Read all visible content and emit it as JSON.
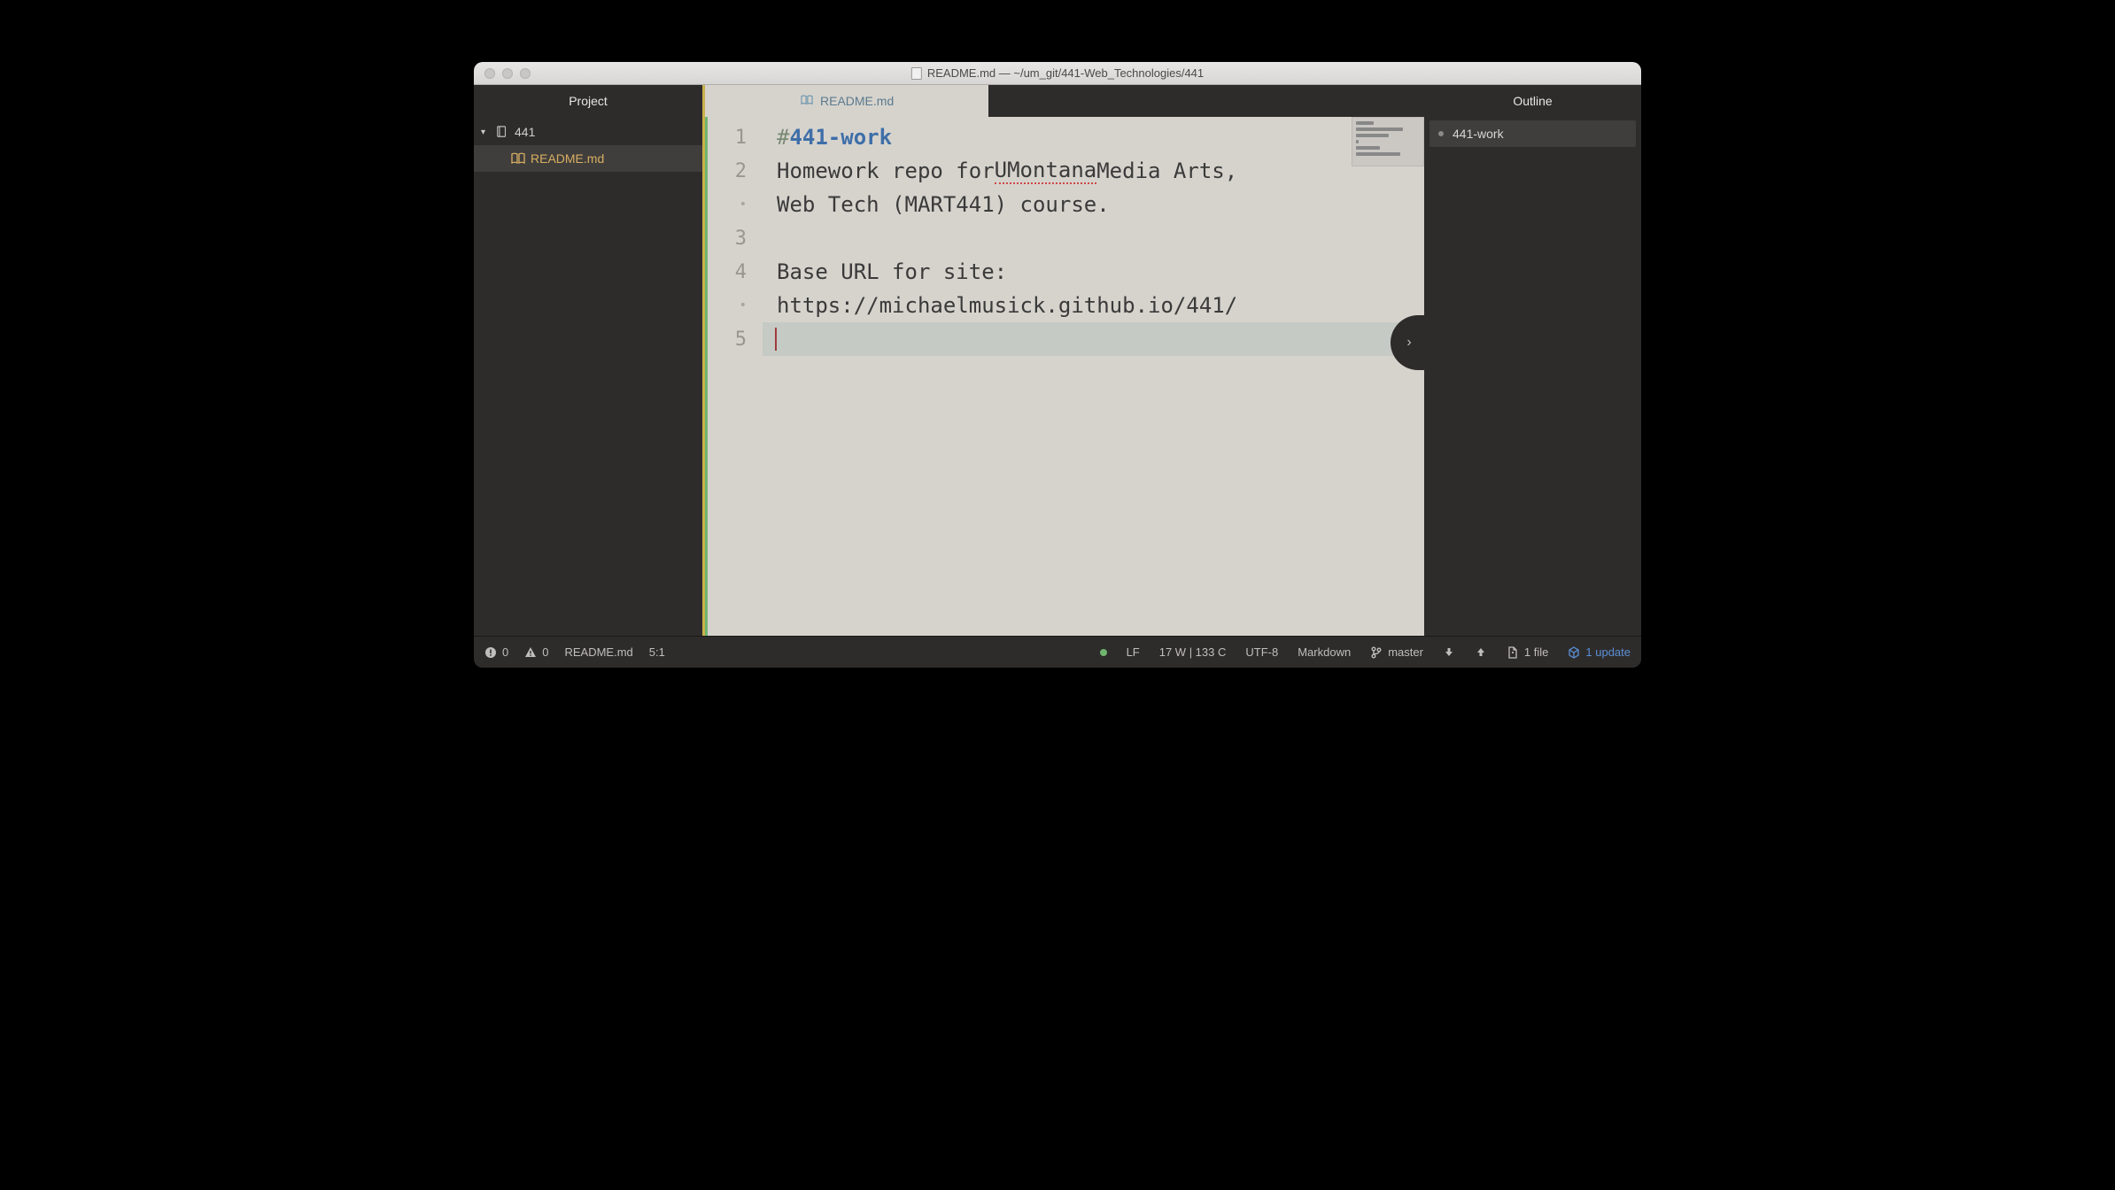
{
  "window": {
    "title": "README.md — ~/um_git/441-Web_Technologies/441"
  },
  "sidebar": {
    "header": "Project",
    "root": "441",
    "file": "README.md"
  },
  "tab": {
    "label": "README.md"
  },
  "editor": {
    "gutter": [
      "1",
      "2",
      "•",
      "3",
      "4",
      "•",
      "5"
    ],
    "line1_hash": "# ",
    "line1_heading": "441-work",
    "line2_pre": "Homework repo for ",
    "line2_err": "UMontana",
    "line2_post": " Media Arts,",
    "line2b": "Web Tech (MART441) course.",
    "line4": "Base URL for site:",
    "line4b": "https://michaelmusick.github.io/441/"
  },
  "outline": {
    "header": "Outline",
    "item": "441-work"
  },
  "status": {
    "errors": "0",
    "warnings": "0",
    "filename": "README.md",
    "cursor": "5:1",
    "eol": "LF",
    "wc": "17 W | 133 C",
    "encoding": "UTF-8",
    "lang": "Markdown",
    "branch": "master",
    "files": "1 file",
    "update": "1 update"
  }
}
